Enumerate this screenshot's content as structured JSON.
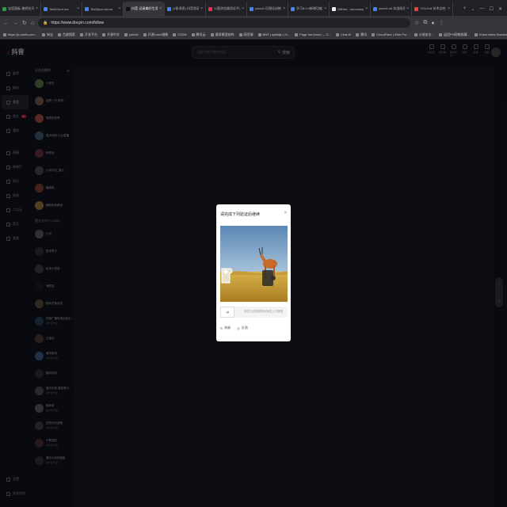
{
  "browser": {
    "tabs": [
      {
        "label": "宝塔面板-曾经在开发板",
        "color": "#20a53a"
      },
      {
        "label": "Test2Json.ms",
        "color": "#4285f4"
      },
      {
        "label": "Test2json.demo",
        "color": "#4285f4"
      },
      {
        "label": "抖音-记录美好生活",
        "color": "#111111",
        "active": true
      },
      {
        "label": "(4条消息) 抖音验证滑块",
        "color": "#4285f4"
      },
      {
        "label": "火狐浏览器验证平台",
        "color": "#fe2c55"
      },
      {
        "label": "yolov5-可视化训练工具",
        "color": "#4285f4"
      },
      {
        "label": "学习8.0.0新增功能Ultrafro",
        "color": "#4285f4"
      },
      {
        "label": "GitHub - shouxiang/learn",
        "color": "#eeeeee"
      },
      {
        "label": "yolov5-v5 实战检测模型",
        "color": "#4285f4"
      },
      {
        "label": "YOLOv8 技术点的比较",
        "color": "#e8453c"
      }
    ],
    "url": "https://www.douyin.com/follow",
    "bookmarks": [
      "https://jx.xmflv.com...",
      "淘宝",
      "百度搜索",
      "开发平台",
      "开源中文",
      "yolov5",
      "开源Linux镜像",
      "CSDN",
      "腾讯云",
      "通用模型结构",
      "网页端",
      "BNS | sytdajiu | G...",
      "Page not found — G...",
      "Chat AI",
      "腾讯",
      "CloudFlare | Web Per...",
      "火绒安全...",
      "返回PH网络收藏...",
      "Kubernetes Dashbo...",
      "工具",
      "阿里云控制台",
      "腾讯云",
      "数据",
      "管理器位置"
    ],
    "tab_controls": [
      "+",
      "⌄",
      "—",
      "☐",
      "✕"
    ]
  },
  "app": {
    "logo": "抖音",
    "search_placeholder": "搜索你感兴趣的内容",
    "search_button": "搜索",
    "toptools": [
      "充钻石",
      "客户端",
      "快捷访问",
      "通知",
      "私信",
      "投稿"
    ],
    "nav": [
      {
        "label": "推荐",
        "icon": "home-icon"
      },
      {
        "label": "精选",
        "icon": "star-icon"
      },
      {
        "label": "关注",
        "icon": "follow-icon",
        "active": true
      },
      {
        "label": "朋友",
        "icon": "friends-icon",
        "badge": "1"
      },
      {
        "label": "我的",
        "icon": "user-icon"
      }
    ],
    "nav2": [
      {
        "label": "直播",
        "icon": "live-icon"
      },
      {
        "label": "放映厅",
        "icon": "cinema-icon"
      },
      {
        "label": "知识",
        "icon": "book-icon"
      },
      {
        "label": "游戏",
        "icon": "game-icon"
      },
      {
        "label": "二次元",
        "icon": "anime-icon"
      },
      {
        "label": "音乐",
        "icon": "music-icon"
      },
      {
        "label": "美食",
        "icon": "food-icon"
      }
    ],
    "nav_bottom": [
      {
        "label": "设置",
        "icon": "settings-icon"
      },
      {
        "label": "业务合作",
        "icon": "business-icon"
      }
    ],
    "following": {
      "header": "正在直播的",
      "live": [
        {
          "name": "小爱豆",
          "color": "#6a8a5a"
        },
        {
          "name": "金数一行 物流...",
          "color": "#8a6a5a"
        },
        {
          "name": "湘潭的老哥",
          "color": "#c45a4a"
        },
        {
          "name": "蓝天网游 小云直播",
          "color": "#4a6a8a"
        },
        {
          "name": "阿珍珠",
          "color": "#7a3a4a"
        },
        {
          "name": "认真不拉_露九",
          "color": "#5a5a5a"
        },
        {
          "name": "姜超说",
          "color": "#9a4a3a"
        },
        {
          "name": "幽默电竞解说",
          "color": "#b88a4a"
        }
      ],
      "header2": "我关注的人(1380)",
      "people": [
        {
          "name": "小米",
          "sub": "",
          "color": "#6a6a6a"
        },
        {
          "name": "哲学男子",
          "sub": "",
          "color": "#3a3a3a"
        },
        {
          "name": "技术小妞妞",
          "sub": "",
          "color": "#4a4a4a"
        },
        {
          "name": "海底捞",
          "sub": "",
          "color": "#222222"
        },
        {
          "name": "程序员鱼皮说",
          "sub": "",
          "color": "#6a5a4a"
        },
        {
          "name": "河南广播电视台民生...",
          "sub": "发布新作品",
          "color": "#2a4a6a"
        },
        {
          "name": "王者的",
          "sub": "",
          "color": "#5a4a3a"
        },
        {
          "name": "果壳新闻",
          "sub": "发布新作品",
          "color": "#4a6a9a"
        },
        {
          "name": "数码测评",
          "sub": "",
          "color": "#3a3a3a"
        },
        {
          "name": "爱开玩笑 看星看月...",
          "sub": "发布新作品",
          "color": "#5a5a5a"
        },
        {
          "name": "懂球帝",
          "sub": "发布新作品",
          "color": "#6a6a7a"
        },
        {
          "name": "这些年的感慨",
          "sub": "发布新作品",
          "color": "#4a4a4a"
        },
        {
          "name": "不焦虑的",
          "sub": "发布新作品",
          "color": "#5a3a3a"
        },
        {
          "name": "爱吃大米的姐姐",
          "sub": "发布新作品",
          "color": "#3a3a4a"
        }
      ]
    },
    "scroll_controls": {
      "up": "⌃",
      "down": "⌄"
    }
  },
  "captcha": {
    "title": "请完成下列验证后继续",
    "close": "✕",
    "slider_hint": "按住左边按钮拖动完成上方拼图",
    "handle_arrow": "➜",
    "refresh": "刷新",
    "feedback": "反馈"
  }
}
